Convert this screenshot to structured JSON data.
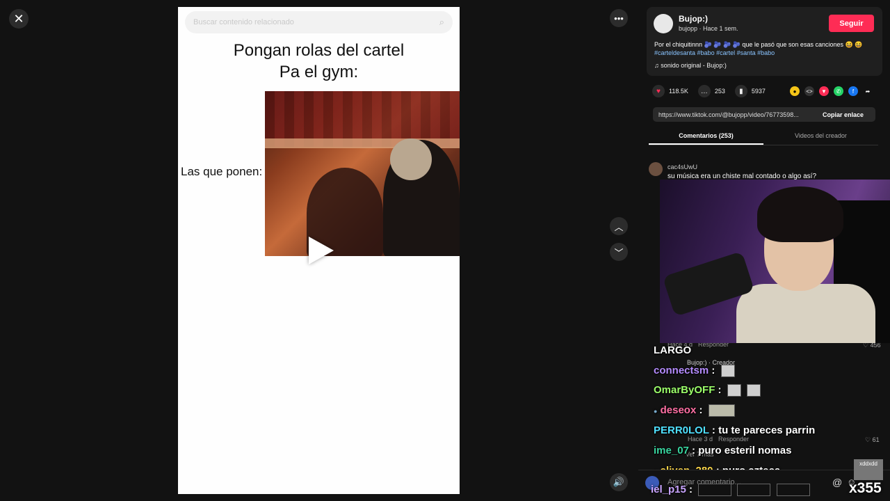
{
  "viewer": {
    "search_placeholder": "Buscar contenido relacionado",
    "meme_title_line1": "Pongan rolas del cartel",
    "meme_title_line2": "Pa el gym:",
    "meme_label": "Las que ponen:"
  },
  "post": {
    "author_name": "Bujop:)",
    "author_meta": "bujopp · Hace 1 sem.",
    "follow_label": "Seguir",
    "description": "Por el chiquitinnn 🫐 🫐 🫐 🫐 que le pasó que son esas canciones 😆 😆",
    "hashtags": "#carteldesanta #babo #cartel #santa #babo",
    "sound": "sonido original - Bujop:)",
    "likes": "118.5K",
    "comments": "253",
    "saves": "5937",
    "url": "https://www.tiktok.com/@bujopp/video/76773598...",
    "copy_label": "Copiar enlace"
  },
  "tabs": {
    "comments": "Comentarios (253)",
    "creator_videos": "Videos del creador"
  },
  "comments": [
    {
      "user": "cac4sUwU",
      "text": "su música era un chiste mal contado o algo así?"
    }
  ],
  "comment_meta": {
    "time1": "Hace 4 d",
    "reply1": "Responder",
    "likes1": "456",
    "creator": "Bujop:) · Creador",
    "time2": "Hace 3 d",
    "reply2": "Responder",
    "likes2": "61",
    "more": "Ver 7 más"
  },
  "stream_chat": [
    {
      "user": "LARGO",
      "color": "#ffffff",
      "msg": ""
    },
    {
      "user": "connectsm",
      "color": "#b58cff",
      "msg": ":"
    },
    {
      "user": "OmarByOFF",
      "color": "#9cff6a",
      "msg": ":"
    },
    {
      "user": "deseox",
      "color": "#ff6fa3",
      "msg": ":"
    },
    {
      "user": "PERR0LOL",
      "color": "#4fe0ff",
      "msg": ": tu te pareces parrin"
    },
    {
      "user": "ime_07",
      "color": "#39d6a0",
      "msg": ": puro esteril nomas"
    },
    {
      "user": "aliyen_280",
      "color": "#ffd84a",
      "msg": ": puro azteca"
    },
    {
      "user": "iel_p15",
      "color": "#c9a4ff",
      "msg": ":"
    }
  ],
  "comment_input": {
    "placeholder": "Agregar comentario...",
    "at_symbol": "@"
  },
  "overlay": {
    "counter": "x355",
    "emote_label": "xddxdd"
  }
}
